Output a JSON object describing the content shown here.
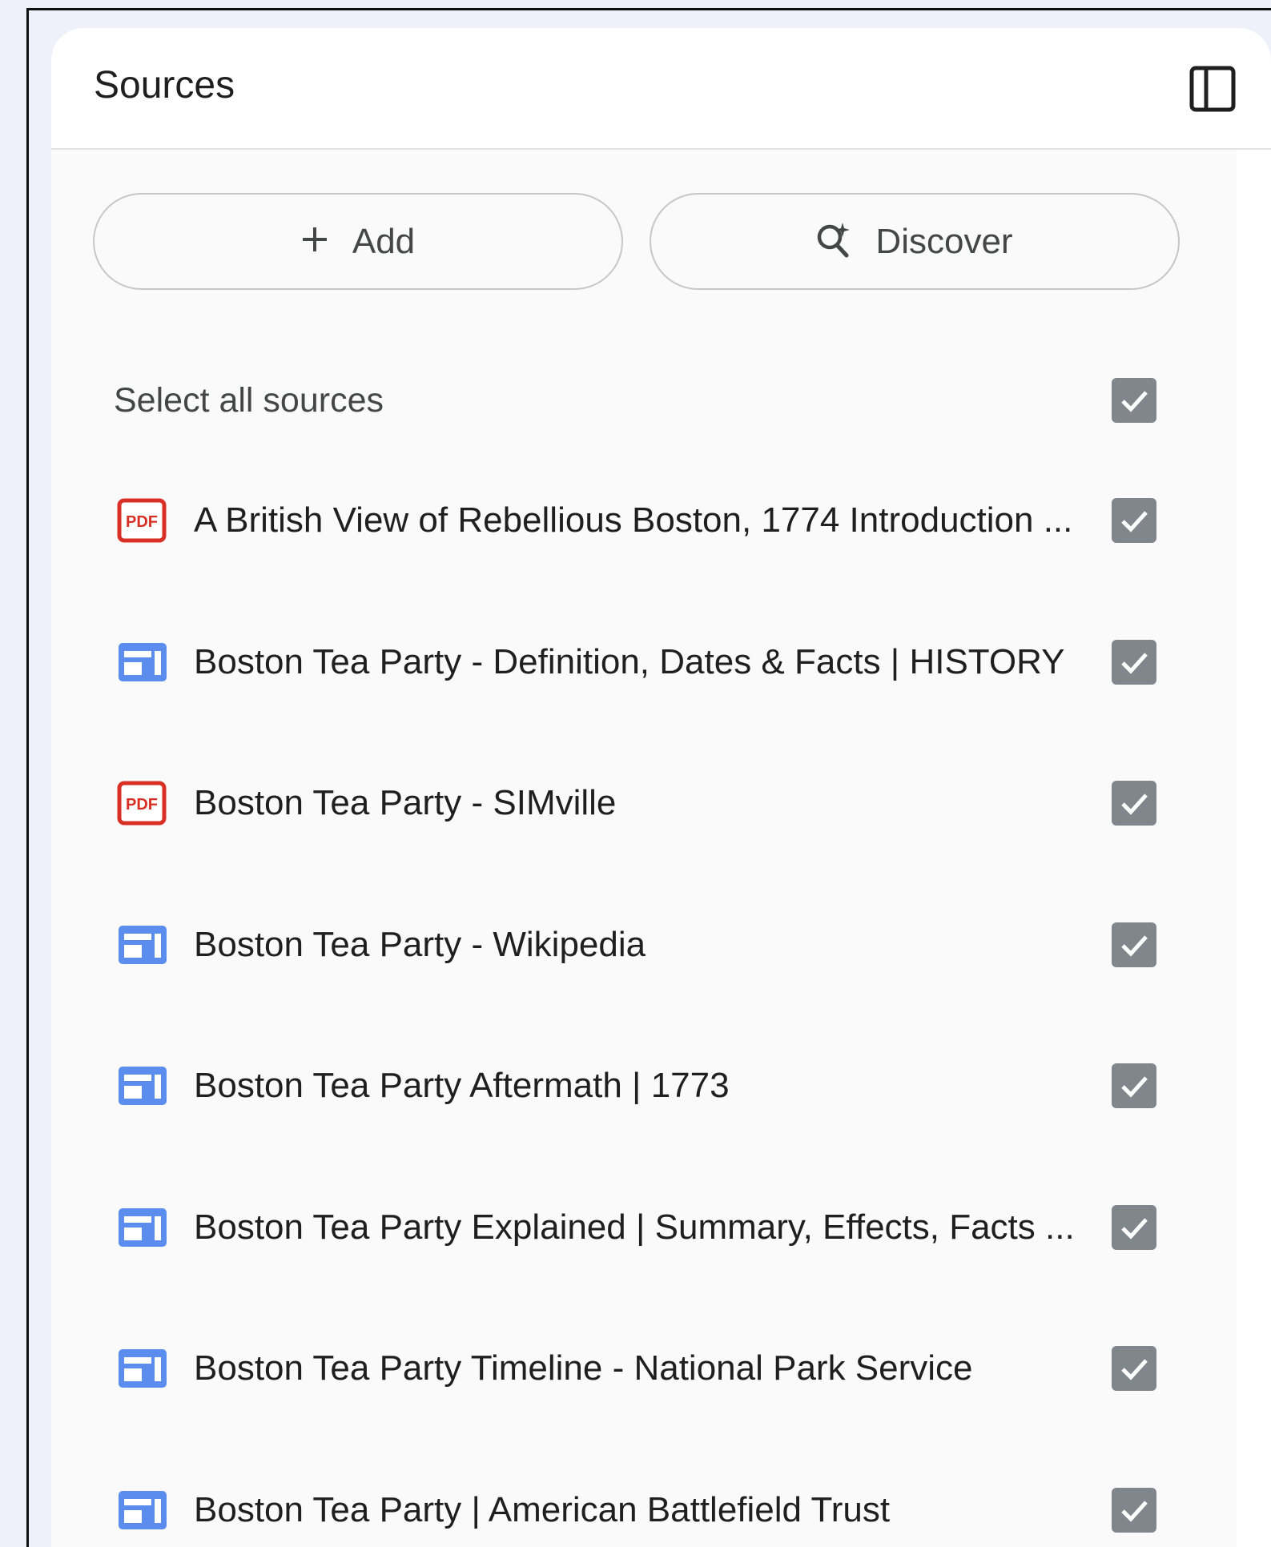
{
  "header": {
    "title": "Sources",
    "collapse_icon": "panel-collapse-icon"
  },
  "actions": {
    "add_label": "Add",
    "add_icon": "plus-icon",
    "discover_label": "Discover",
    "discover_icon": "sparkle-search-icon"
  },
  "select_all": {
    "label": "Select all sources",
    "checked": true
  },
  "sources": [
    {
      "type": "pdf",
      "icon": "pdf-icon",
      "title": "A British View of Rebellious Boston, 1774 Introduction ...",
      "checked": true
    },
    {
      "type": "web",
      "icon": "web-page-icon",
      "title": "Boston Tea Party - Definition, Dates & Facts | HISTORY",
      "checked": true
    },
    {
      "type": "pdf",
      "icon": "pdf-icon",
      "title": "Boston Tea Party - SIMville",
      "checked": true
    },
    {
      "type": "web",
      "icon": "web-page-icon",
      "title": "Boston Tea Party - Wikipedia",
      "checked": true
    },
    {
      "type": "web",
      "icon": "web-page-icon",
      "title": "Boston Tea Party Aftermath | 1773",
      "checked": true
    },
    {
      "type": "web",
      "icon": "web-page-icon",
      "title": "Boston Tea Party Explained | Summary, Effects, Facts ...",
      "checked": true
    },
    {
      "type": "web",
      "icon": "web-page-icon",
      "title": "Boston Tea Party Timeline - National Park Service",
      "checked": true
    },
    {
      "type": "web",
      "icon": "web-page-icon",
      "title": "Boston Tea Party | American Battlefield Trust",
      "checked": true
    }
  ],
  "colors": {
    "pdf_red": "#d93025",
    "web_blue": "#5b8def",
    "checkbox_gray": "#80868b"
  }
}
